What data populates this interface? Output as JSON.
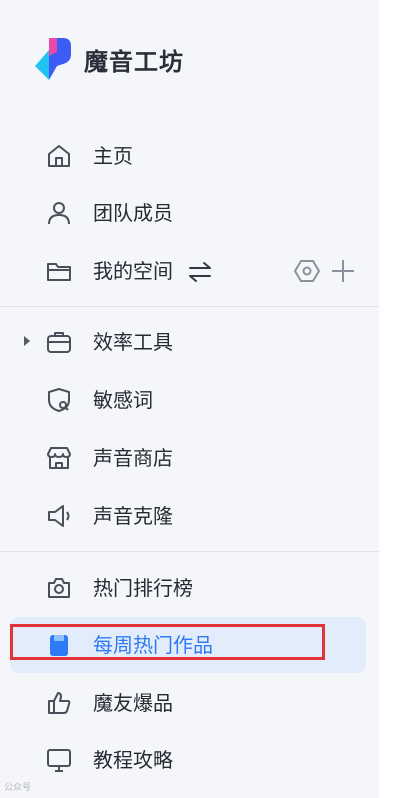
{
  "app": {
    "title": "魔音工坊"
  },
  "nav": {
    "home": "主页",
    "team": "团队成员",
    "space": "我的空间",
    "tools": "效率工具",
    "sensitive": "敏感词",
    "store": "声音商店",
    "clone": "声音克隆",
    "hot": "热门排行榜",
    "weekly": "每周热门作品",
    "friends": "魔友爆品",
    "tutorial": "教程攻略"
  },
  "icons": {
    "home": "home-icon",
    "team": "user-icon",
    "space": "folder-icon",
    "swap": "swap-icon",
    "settings": "hexagon-settings-icon",
    "add": "plus-icon",
    "tools": "briefcase-icon",
    "sensitive": "shield-search-icon",
    "store": "store-icon",
    "clone": "speaker-icon",
    "hot": "camera-badge-icon",
    "weekly": "book-icon",
    "friends": "thumbs-up-icon",
    "tutorial": "monitor-icon"
  },
  "colors": {
    "accent": "#2f7af5",
    "active_bg": "#e3ecfb",
    "highlight": "#e23434"
  },
  "watermark": "公众号"
}
